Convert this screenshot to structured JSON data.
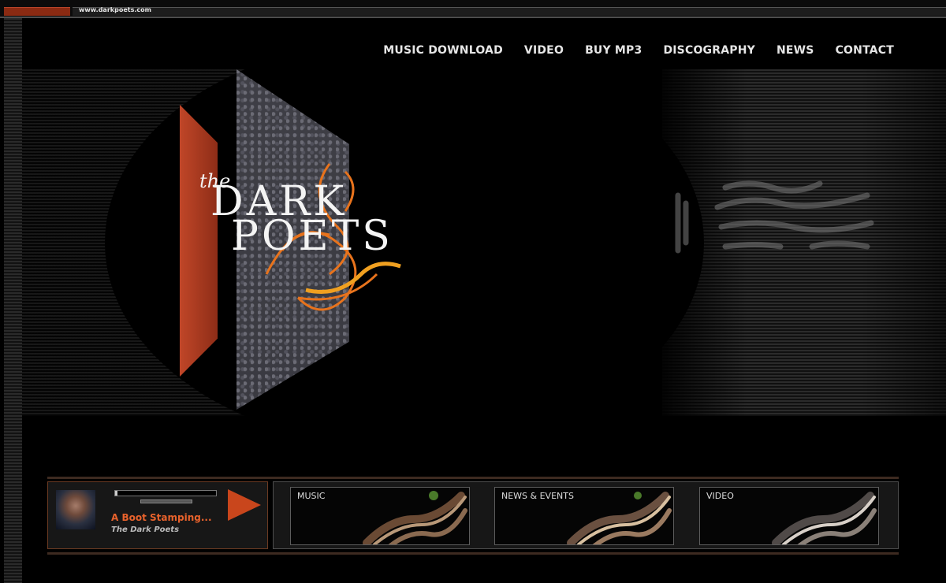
{
  "browser": {
    "url": "www.darkpoets.com"
  },
  "nav": {
    "items": [
      {
        "label": "MUSIC DOWNLOAD"
      },
      {
        "label": "VIDEO"
      },
      {
        "label": "BUY MP3"
      },
      {
        "label": "DISCOGRAPHY"
      },
      {
        "label": "NEWS"
      },
      {
        "label": "CONTACT"
      }
    ]
  },
  "hero": {
    "logo_the": "the",
    "logo_line1": "DARK",
    "logo_line2": "POETS",
    "accent_color": "#c04628",
    "swirl_color": "#e8731c"
  },
  "player": {
    "track_title": "A Boot Stamping...",
    "artist": "The Dark Poets",
    "play_icon": "play-icon",
    "progress": 0.01,
    "accent_color": "#c9461c"
  },
  "sections": [
    {
      "label": "MUSIC"
    },
    {
      "label": "NEWS & EVENTS"
    },
    {
      "label": "VIDEO"
    }
  ]
}
